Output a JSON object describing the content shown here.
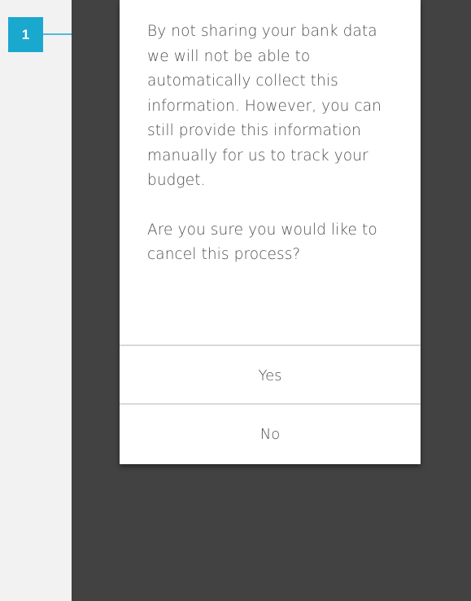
{
  "annotation": {
    "badge_number": "1",
    "color": "#1ba8cf"
  },
  "dialog": {
    "message_paragraph_1": "By not sharing your bank data we will not be able to automatically collect this information. However, you can still provide this information manually for us to track your budget.",
    "message_paragraph_2": "Are you sure you would like to cancel this process?",
    "yes_label": "Yes",
    "no_label": "No"
  },
  "colors": {
    "page_background": "#f2f2f2",
    "device_background": "#424242",
    "dialog_background": "#ffffff",
    "text": "#4f4f4f",
    "divider": "#d9d9d9"
  }
}
